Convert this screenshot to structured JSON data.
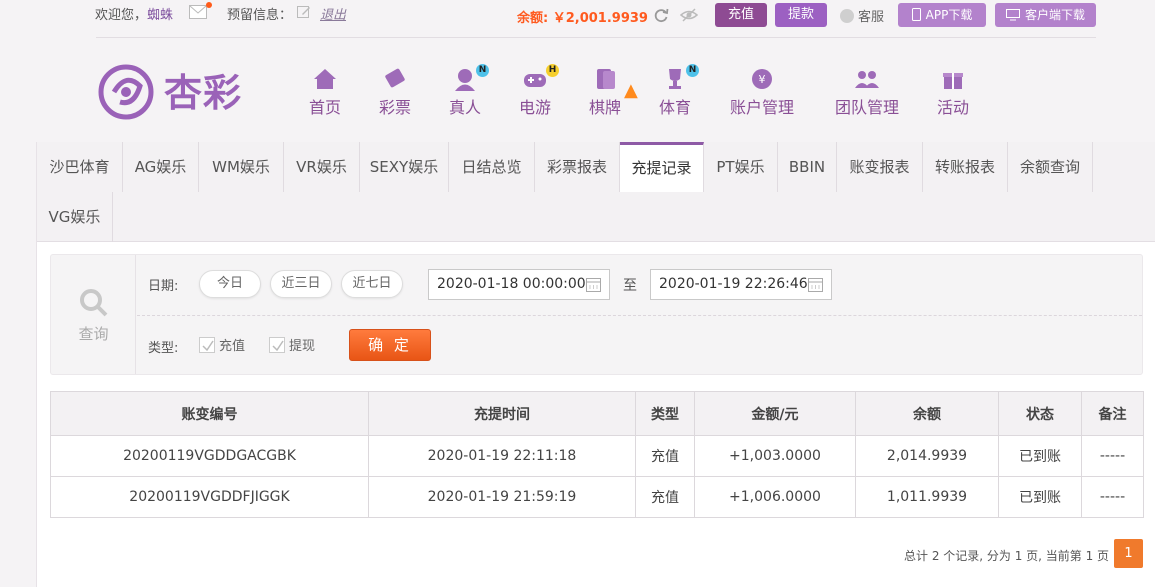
{
  "header": {
    "welcome": "欢迎您，",
    "username": "蜘蛛",
    "reserve_info": "预留信息：",
    "logout": "退出",
    "balance": "余额: ￥2,001.9939",
    "deposit": "充值",
    "withdraw": "提款",
    "service": "客服",
    "app_download": "APP下载",
    "client_download": "客户端下载"
  },
  "brand": {
    "logo_text": "杏彩"
  },
  "nav": [
    {
      "label": "首页",
      "icon": "home-icon"
    },
    {
      "label": "彩票",
      "icon": "lottery-ticket-icon"
    },
    {
      "label": "真人",
      "icon": "live-dealer-icon",
      "badge": "N"
    },
    {
      "label": "电游",
      "icon": "gamepad-icon",
      "badge": "H"
    },
    {
      "label": "棋牌",
      "icon": "cards-icon"
    },
    {
      "label": "体育",
      "icon": "trophy-icon",
      "badge": "N"
    },
    {
      "label": "账户管理",
      "icon": "yen-coin-icon"
    },
    {
      "label": "团队管理",
      "icon": "team-icon"
    },
    {
      "label": "活动",
      "icon": "gift-icon"
    }
  ],
  "tabs": [
    "沙巴体育",
    "AG娱乐",
    "WM娱乐",
    "VR娱乐",
    "SEXY娱乐",
    "日结总览",
    "彩票报表",
    "充提记录",
    "PT娱乐",
    "BBIN",
    "账变报表",
    "转账报表",
    "余额查询",
    "VG娱乐"
  ],
  "active_tab": "充提记录",
  "search": {
    "icon_label": "查询",
    "date_label": "日期:",
    "today": "今日",
    "three_days": "近三日",
    "seven_days": "近七日",
    "date_from": "2020-01-18 00:00:00",
    "to": "至",
    "date_to": "2020-01-19 22:26:46",
    "type_label": "类型:",
    "type_deposit": "充值",
    "type_withdraw": "提现",
    "confirm": "确 定"
  },
  "table": {
    "headers": [
      "账变编号",
      "充提时间",
      "类型",
      "金额/元",
      "余额",
      "状态",
      "备注"
    ],
    "rows": [
      [
        "20200119VGDDGACGBK",
        "2020-01-19 22:11:18",
        "充值",
        "+1,003.0000",
        "2,014.9939",
        "已到账",
        "-----"
      ],
      [
        "20200119VGDDFJIGGK",
        "2020-01-19 21:59:19",
        "充值",
        "+1,006.0000",
        "1,011.9939",
        "已到账",
        "-----"
      ]
    ]
  },
  "pager": {
    "summary": "总计 2 个记录, 分为 1 页, 当前第 1 页",
    "current": "1"
  },
  "colors": {
    "brand": "#8e4b93",
    "accent": "#ff5a1f",
    "amount": "#d41c1c",
    "status_ok": "#2aa02a"
  }
}
